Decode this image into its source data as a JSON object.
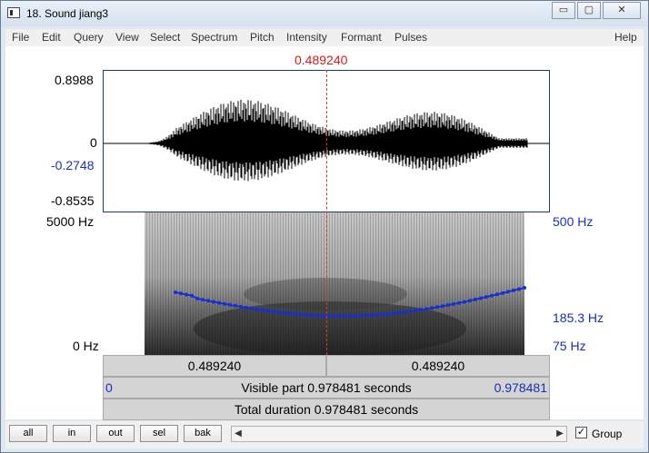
{
  "window": {
    "title": "18. Sound jiang3",
    "controls": {
      "minimize": "▭",
      "maximize": "▢",
      "close": "✕"
    }
  },
  "menu": [
    "File",
    "Edit",
    "Query",
    "View",
    "Select",
    "Spectrum",
    "Pitch",
    "Intensity",
    "Formant",
    "Pulses"
  ],
  "menu_help": "Help",
  "cursor": {
    "time": "0.489240"
  },
  "waveform": {
    "max": "0.8988",
    "zero": "0",
    "cursor_value": "-0.2748",
    "min": "-0.8535"
  },
  "spectrogram": {
    "top_freq": "5000 Hz",
    "bottom_freq": "0 Hz",
    "pitch_top": "500 Hz",
    "pitch_value": "185.3 Hz",
    "pitch_bottom": "75 Hz"
  },
  "selection_bar": {
    "left": "0.489240",
    "right": "0.489240"
  },
  "visible_bar": {
    "start": "0",
    "text": "Visible part 0.978481 seconds",
    "end": "0.978481"
  },
  "total_bar": {
    "text": "Total duration 0.978481 seconds"
  },
  "buttons": [
    "all",
    "in",
    "out",
    "sel",
    "bak"
  ],
  "group": {
    "label": "Group",
    "checked": true
  },
  "colors": {
    "cursor": "#e23030",
    "pitch": "#1a2fd0",
    "axis_blue": "#1a2fb0"
  }
}
